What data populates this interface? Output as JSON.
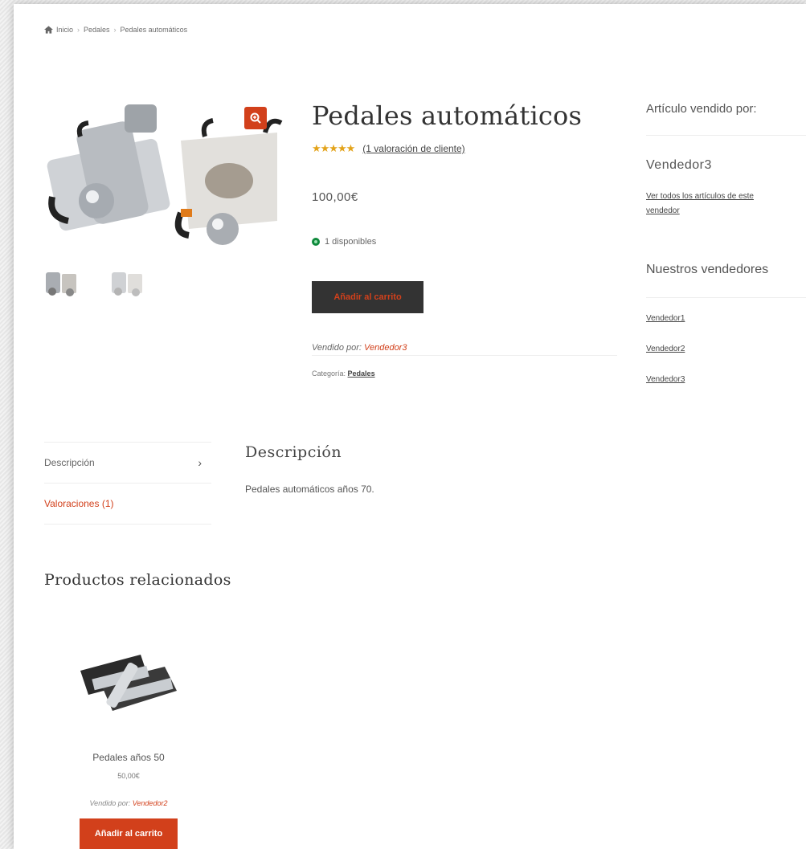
{
  "breadcrumb": {
    "home": "Inicio",
    "category": "Pedales",
    "current": "Pedales automáticos"
  },
  "product": {
    "title": "Pedales automáticos",
    "rating_stars": 5,
    "rating_link": "(1 valoración de cliente)",
    "price": "100,00€",
    "stock": "1 disponibles",
    "add_to_cart": "Añadir al carrito",
    "sold_by_label": "Vendido por:",
    "sold_by_vendor": "Vendedor3",
    "category_label": "Categoría:",
    "category_value": "Pedales"
  },
  "sidebar": {
    "sold_by_title": "Artículo vendido por:",
    "vendor_name": "Vendedor3",
    "see_all_link": "Ver todos los artículos de este vendedor",
    "our_vendors_title": "Nuestros vendedores",
    "vendors": [
      "Vendedor1",
      "Vendedor2",
      "Vendedor3"
    ]
  },
  "tabs": {
    "description": "Descripción",
    "reviews": "Valoraciones (1)"
  },
  "description": {
    "title": "Descripción",
    "text": "Pedales automáticos años 70."
  },
  "related": {
    "title": "Productos relacionados",
    "items": [
      {
        "name": "Pedales años 50",
        "price": "50,00€",
        "sold_by_label": "Vendido por:",
        "sold_by_vendor": "Vendedor2",
        "button": "Añadir al carrito"
      }
    ]
  },
  "colors": {
    "accent": "#d2401b",
    "star": "#e3a31a",
    "stock": "#0f8a3c",
    "dark_button": "#333333"
  }
}
